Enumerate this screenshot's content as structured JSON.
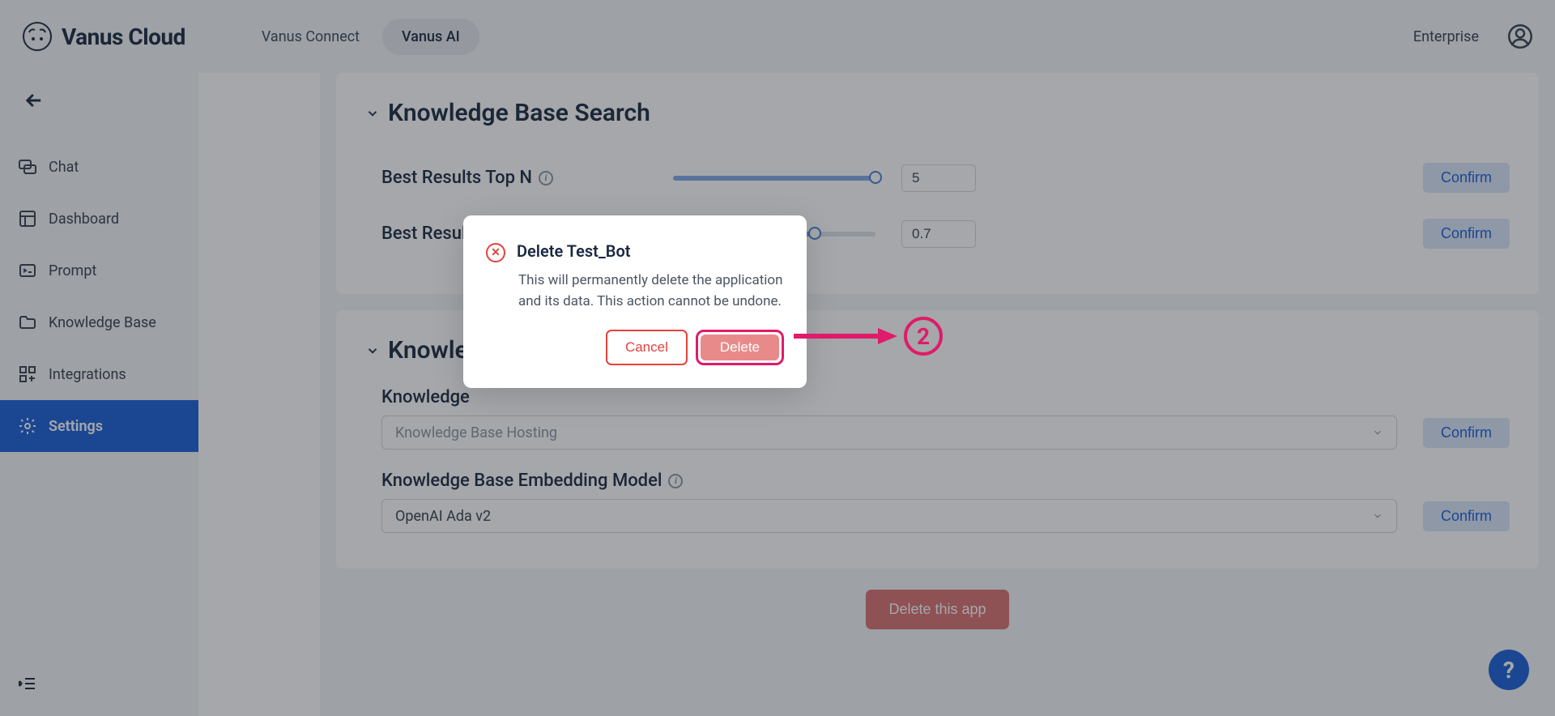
{
  "header": {
    "app_title": "Vanus Cloud",
    "nav": {
      "connect": "Vanus Connect",
      "ai": "Vanus AI"
    },
    "enterprise": "Enterprise"
  },
  "sidebar": {
    "items": [
      {
        "label": "Chat"
      },
      {
        "label": "Dashboard"
      },
      {
        "label": "Prompt"
      },
      {
        "label": "Knowledge Base"
      },
      {
        "label": "Integrations"
      },
      {
        "label": "Settings"
      }
    ]
  },
  "sections": {
    "search": {
      "title": "Knowledge Base Search",
      "topn_label": "Best Results Top N",
      "topn_value": "5",
      "threshold_label": "Best Results Match Threshold",
      "threshold_value": "0.7",
      "confirm": "Confirm"
    },
    "kb": {
      "title": "Knowledge",
      "hosting_label": "Knowledge",
      "hosting_placeholder": "Knowledge Base Hosting",
      "embed_label": "Knowledge Base Embedding Model",
      "embed_value": "OpenAI Ada v2",
      "confirm": "Confirm"
    }
  },
  "delete_app_btn": "Delete this app",
  "modal": {
    "title": "Delete Test_Bot",
    "body": "This will permanently delete the application and its data. This action cannot be undone.",
    "cancel": "Cancel",
    "delete": "Delete"
  },
  "annotation": {
    "step": "2"
  },
  "help": "?"
}
